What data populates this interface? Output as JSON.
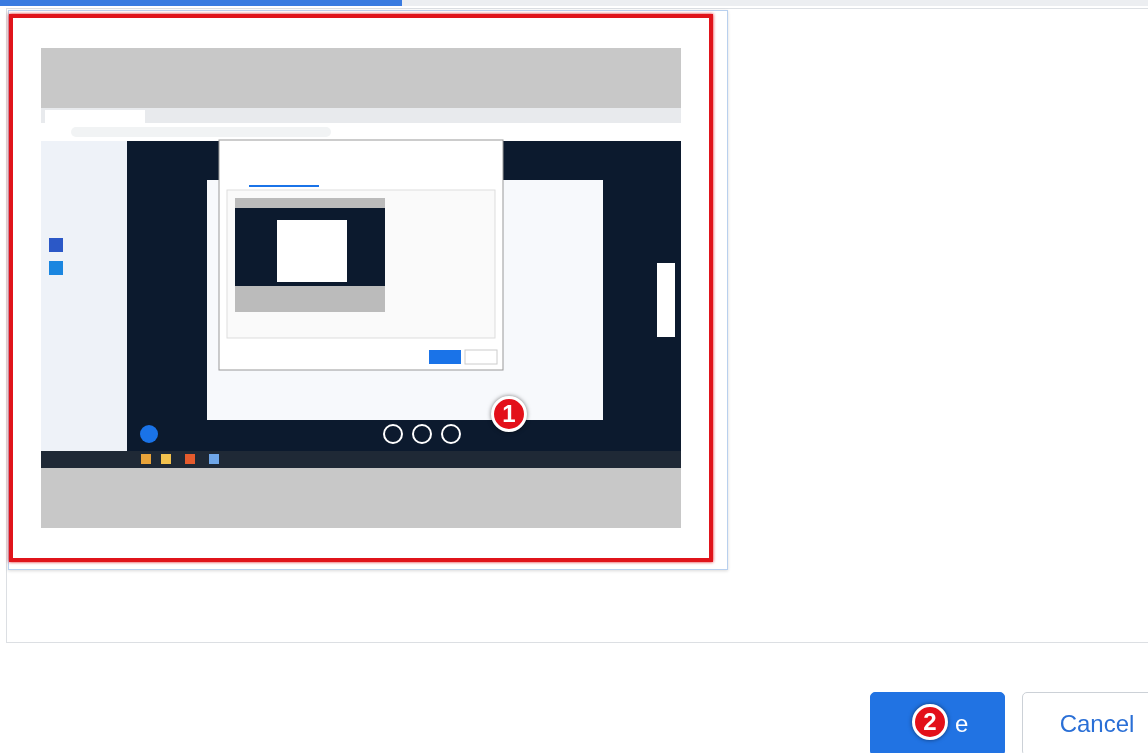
{
  "progress": {
    "level": 0.35
  },
  "screen_option": {
    "selected": true,
    "badge": "1"
  },
  "buttons": [
    {
      "label": "e",
      "kind": "primary",
      "badge": "2"
    },
    {
      "label": "Cancel",
      "kind": "secondary"
    }
  ]
}
